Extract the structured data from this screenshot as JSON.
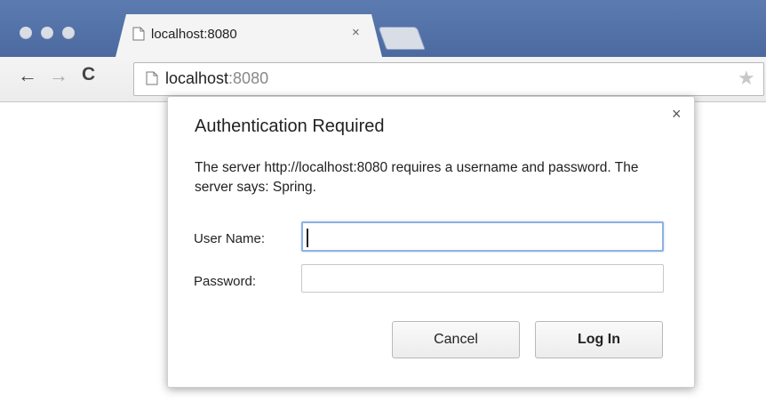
{
  "window": {
    "traffic_lights": [
      "close",
      "minimize",
      "zoom"
    ]
  },
  "tab": {
    "title": "localhost:8080",
    "close_glyph": "×"
  },
  "toolbar": {
    "back_glyph": "←",
    "forward_glyph": "→",
    "reload_glyph": "C",
    "url_host": "localhost",
    "url_port": ":8080",
    "star_glyph": "★"
  },
  "dialog": {
    "title": "Authentication Required",
    "close_glyph": "×",
    "message": "The server http://localhost:8080 requires a username and password. The server says: Spring.",
    "username_label": "User Name:",
    "username_value": "",
    "password_label": "Password:",
    "password_value": "",
    "cancel_label": "Cancel",
    "login_label": "Log In"
  },
  "colors": {
    "titlebar": "#5b7bb1",
    "focus_ring": "#8fb0e3"
  },
  "icons": [
    "page-icon",
    "back-arrow-icon",
    "forward-arrow-icon",
    "reload-icon",
    "star-icon",
    "close-icon"
  ]
}
